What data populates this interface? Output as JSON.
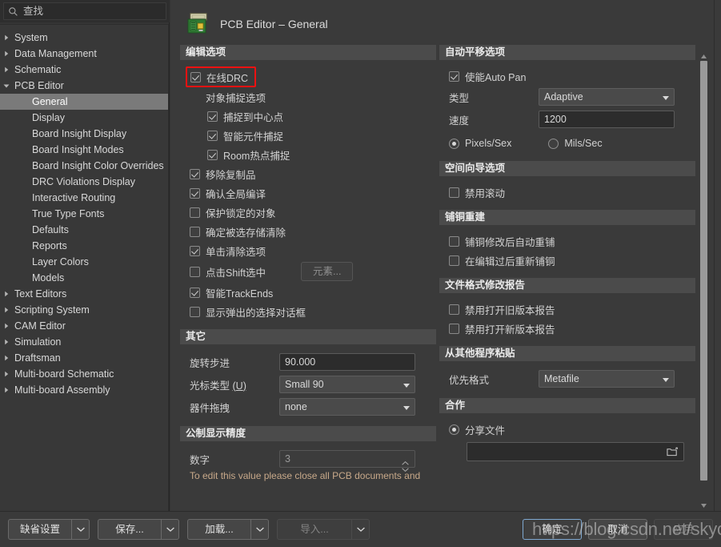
{
  "search": {
    "placeholder": "查找",
    "value": "",
    "icon": "search-icon"
  },
  "sidebar": {
    "items": [
      {
        "label": "System",
        "level": 0,
        "expanded": false,
        "selected": false
      },
      {
        "label": "Data Management",
        "level": 0,
        "expanded": false,
        "selected": false
      },
      {
        "label": "Schematic",
        "level": 0,
        "expanded": false,
        "selected": false
      },
      {
        "label": "PCB Editor",
        "level": 0,
        "expanded": true,
        "selected": false
      },
      {
        "label": "General",
        "level": 1,
        "expanded": null,
        "selected": true
      },
      {
        "label": "Display",
        "level": 1,
        "expanded": null,
        "selected": false
      },
      {
        "label": "Board Insight Display",
        "level": 1,
        "expanded": null,
        "selected": false
      },
      {
        "label": "Board Insight Modes",
        "level": 1,
        "expanded": null,
        "selected": false
      },
      {
        "label": "Board Insight Color Overrides",
        "level": 1,
        "expanded": null,
        "selected": false
      },
      {
        "label": "DRC Violations Display",
        "level": 1,
        "expanded": null,
        "selected": false
      },
      {
        "label": "Interactive Routing",
        "level": 1,
        "expanded": null,
        "selected": false
      },
      {
        "label": "True Type Fonts",
        "level": 1,
        "expanded": null,
        "selected": false
      },
      {
        "label": "Defaults",
        "level": 1,
        "expanded": null,
        "selected": false
      },
      {
        "label": "Reports",
        "level": 1,
        "expanded": null,
        "selected": false
      },
      {
        "label": "Layer Colors",
        "level": 1,
        "expanded": null,
        "selected": false
      },
      {
        "label": "Models",
        "level": 1,
        "expanded": null,
        "selected": false
      },
      {
        "label": "Text Editors",
        "level": 0,
        "expanded": false,
        "selected": false
      },
      {
        "label": "Scripting System",
        "level": 0,
        "expanded": false,
        "selected": false
      },
      {
        "label": "CAM Editor",
        "level": 0,
        "expanded": false,
        "selected": false
      },
      {
        "label": "Simulation",
        "level": 0,
        "expanded": false,
        "selected": false
      },
      {
        "label": "Draftsman",
        "level": 0,
        "expanded": false,
        "selected": false
      },
      {
        "label": "Multi-board Schematic",
        "level": 0,
        "expanded": false,
        "selected": false
      },
      {
        "label": "Multi-board Assembly",
        "level": 0,
        "expanded": false,
        "selected": false
      }
    ]
  },
  "header": {
    "title": "PCB Editor – General",
    "icon": "pcb-board-icon"
  },
  "left_column": {
    "editing_options": {
      "title": "编辑选项",
      "online_drc": {
        "label": "在线DRC",
        "checked": true,
        "highlighted": true
      },
      "snap_group_label": "对象捕捉选项",
      "snap_to_center": {
        "label": "捕捉到中心点",
        "checked": true
      },
      "smart_component_snap": {
        "label": "智能元件捕捉",
        "checked": true
      },
      "room_hotspot_snap": {
        "label": "Room热点捕捉",
        "checked": true
      },
      "remove_duplicates": {
        "label": "移除复制品",
        "checked": true
      },
      "confirm_global_edit": {
        "label": "确认全局编译",
        "checked": true
      },
      "protect_locked": {
        "label": "保护锁定的对象",
        "checked": false
      },
      "confirm_selection_clear": {
        "label": "确定被选存储清除",
        "checked": false
      },
      "click_clears_selection": {
        "label": "单击清除选项",
        "checked": true
      },
      "shift_click_to_select": {
        "label": "点击Shift选中",
        "checked": false
      },
      "elements_button": {
        "label": "元素...",
        "enabled": false
      },
      "smart_trackends": {
        "label": "智能TrackEnds",
        "checked": true
      },
      "show_popup_select_dialog": {
        "label": "显示弹出的选择对话框",
        "checked": false
      }
    },
    "other": {
      "title": "其它",
      "rotation_step": {
        "label": "旋转步进",
        "value": "90.000"
      },
      "cursor_type": {
        "label": "光标类型",
        "hotkey": "U",
        "value": "Small 90"
      },
      "comp_drag": {
        "label": "器件拖拽",
        "value": "none"
      }
    },
    "metric_precision": {
      "title": "公制显示精度",
      "digits": {
        "label": "数字",
        "value": "3",
        "enabled": false
      },
      "note": "To edit this value please close all PCB documents and"
    }
  },
  "right_column": {
    "auto_pan": {
      "title": "自动平移选项",
      "enable": {
        "label": "使能Auto Pan",
        "checked": true
      },
      "style": {
        "label": "类型",
        "value": "Adaptive"
      },
      "speed": {
        "label": "速度",
        "value": "1200"
      },
      "pixels_sec": {
        "label": "Pixels/Sex",
        "checked": true
      },
      "mils_sec": {
        "label": "Mils/Sec",
        "checked": false
      }
    },
    "space_navigator": {
      "title": "空间向导选项",
      "disable_roll": {
        "label": "禁用滚动",
        "checked": false
      }
    },
    "polygon_rebuild": {
      "title": "铺铜重建",
      "repour_after_edit": {
        "label": "铺铜修改后自动重铺",
        "checked": false
      },
      "repour_after_modify": {
        "label": "在编辑过后重新铺铜",
        "checked": false
      }
    },
    "file_format_report": {
      "title": "文件格式修改报告",
      "disable_open_old": {
        "label": "禁用打开旧版本报告",
        "checked": false
      },
      "disable_open_new": {
        "label": "禁用打开新版本报告",
        "checked": false
      }
    },
    "paste_from_other": {
      "title": "从其他程序粘贴",
      "preferred_format": {
        "label": "优先格式",
        "value": "Metafile"
      }
    },
    "collaboration": {
      "title": "合作",
      "shared_file": {
        "label": "分享文件",
        "checked": true
      },
      "path": {
        "value": "",
        "icon": "folder-open-icon"
      }
    }
  },
  "bottom_bar": {
    "defaults": "缺省设置",
    "save": "保存...",
    "load": "加载...",
    "import": "导入...",
    "ok": "确定",
    "cancel": "取消",
    "apply": "应用"
  },
  "watermark": {
    "text": "https://blog.csdn.net/skycmq"
  },
  "colors": {
    "window_bg": "#353535",
    "panel_bg": "#3a3a3a",
    "section_header": "#4b4b4b",
    "selection": "#7a7a7a",
    "highlight_box": "#ee1111",
    "note_text": "#c8a98a",
    "primary_border": "#7fa8d0"
  }
}
